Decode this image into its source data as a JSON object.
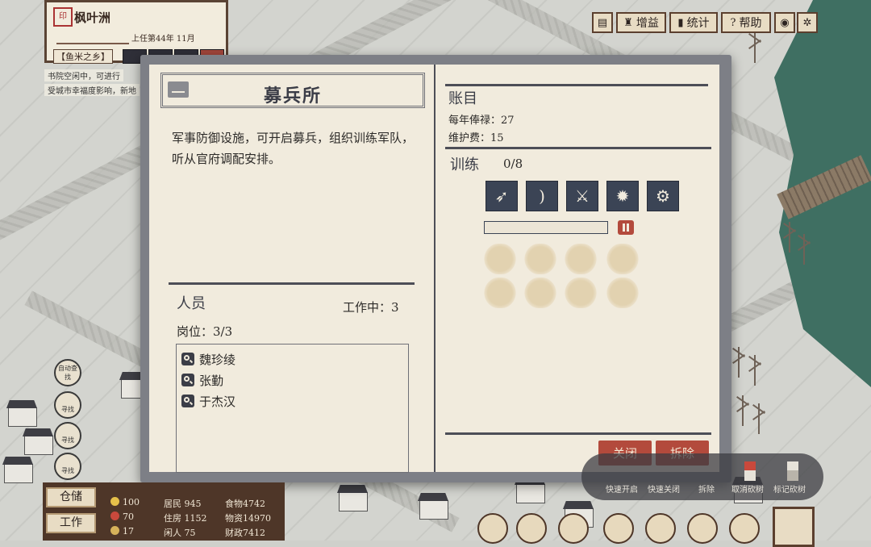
{
  "region": {
    "seal": "印",
    "name": "枫叶洲",
    "date": "上任第44年 11月",
    "subtitle": "【鱼米之乡】"
  },
  "notices": [
    "书院空闲中，可进行",
    "受城市幸福度影响，新地"
  ],
  "toolbar": {
    "buff_label": "增益",
    "stats_label": "统计",
    "help_label": "帮助"
  },
  "dialog": {
    "title": "募兵所",
    "description": "军事防御设施，可开启募兵，组织训练军队，听从官府调配安排。",
    "staff": {
      "heading": "人员",
      "working_label": "工作中：",
      "working_value": "3",
      "posts_label": "岗位：",
      "posts_value": "3/3",
      "members": [
        "魏珍绫",
        "张勤",
        "于杰汉"
      ]
    },
    "accounts": {
      "heading": "账目",
      "salary_label": "每年俸禄：",
      "salary_value": "27",
      "upkeep_label": "维护费：",
      "upkeep_value": "15"
    },
    "training": {
      "heading": "训练",
      "count": "0/8",
      "units": [
        "spear-icon",
        "bow-icon",
        "sword-icon",
        "firebomb-icon",
        "catapult-icon"
      ],
      "progress": 0
    },
    "buttons": {
      "close": "关闭",
      "demolish": "拆除"
    }
  },
  "side_icons": [
    "自动查找",
    "寻找",
    "寻找",
    "寻找"
  ],
  "resources": {
    "storage_btn": "仓储",
    "work_btn": "工作",
    "happiness": "100",
    "health": "70",
    "coins": "17",
    "residents_label": "居民",
    "residents_value": "945",
    "housing_label": "住房",
    "housing_value": "1152",
    "idle_label": "闲人",
    "idle_value": "75",
    "food_label": "食物",
    "food_value": "4742",
    "goods_label": "物资",
    "goods_value": "14970",
    "money_label": "财政",
    "money_value": "7412"
  },
  "tools": {
    "quick_open": "快速开启",
    "quick_close": "快速关闭",
    "demolish": "拆除",
    "cancel_fell": "取消砍树",
    "mark_fell": "标记砍树"
  },
  "colors": {
    "accent_red": "#b34a3c",
    "ink_blue": "#3b4455",
    "paper": "#f1ebdd",
    "sea": "#3f6f62"
  }
}
